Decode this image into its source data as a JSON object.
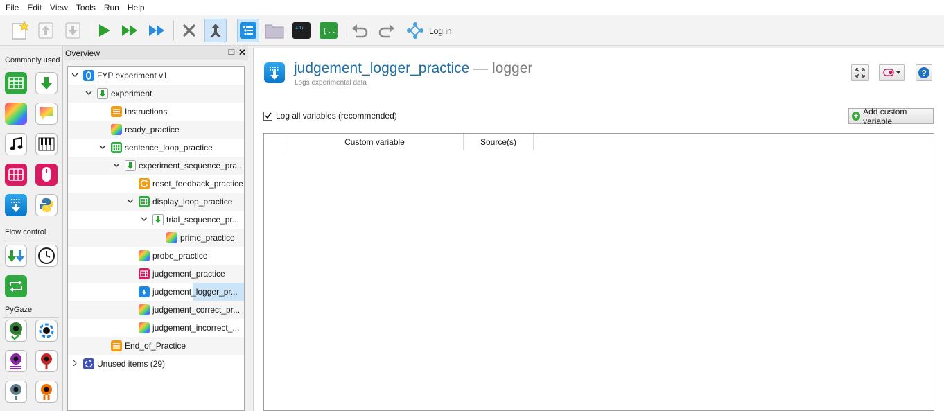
{
  "menu": [
    "File",
    "Edit",
    "View",
    "Tools",
    "Run",
    "Help"
  ],
  "toolbar": {
    "login_label": "Log in",
    "buttons": [
      "new-experiment",
      "move-up",
      "move-down",
      "run",
      "run-in-window",
      "quick-run",
      "kill",
      "merge",
      "overview",
      "file-pool",
      "console",
      "variable-inspector",
      "undo",
      "redo"
    ]
  },
  "itembar": {
    "sections": [
      "Commonly used",
      "Flow control",
      "PyGaze"
    ]
  },
  "overview": {
    "title": "Overview",
    "tree": [
      {
        "label": "FYP experiment v1",
        "icon": "opensesame",
        "level": 0,
        "arrow": "down"
      },
      {
        "label": "experiment",
        "icon": "sequence",
        "level": 1,
        "arrow": "down"
      },
      {
        "label": "Instructions",
        "icon": "form",
        "level": 2,
        "arrow": ""
      },
      {
        "label": "ready_practice",
        "icon": "sketchpad",
        "level": 2,
        "arrow": ""
      },
      {
        "label": "sentence_loop_practice",
        "icon": "loop",
        "level": 2,
        "arrow": "down"
      },
      {
        "label": "experiment_sequence_pra...",
        "icon": "sequence",
        "level": 3,
        "arrow": "down"
      },
      {
        "label": "reset_feedback_practice",
        "icon": "reset",
        "level": 4,
        "arrow": ""
      },
      {
        "label": "display_loop_practice",
        "icon": "loop",
        "level": 4,
        "arrow": "down"
      },
      {
        "label": "trial_sequence_pr...",
        "icon": "sequence",
        "level": 5,
        "arrow": "down"
      },
      {
        "label": "prime_practice",
        "icon": "sketchpad",
        "level": 6,
        "arrow": ""
      },
      {
        "label": "probe_practice",
        "icon": "sketchpad",
        "level": 4,
        "arrow": ""
      },
      {
        "label": "judgement_practice",
        "icon": "keyboard",
        "level": 4,
        "arrow": ""
      },
      {
        "label": "judgement_logger_pr...",
        "icon": "logger",
        "level": 4,
        "arrow": "",
        "selected": true
      },
      {
        "label": "judgement_correct_pr...",
        "icon": "sketchpad",
        "level": 4,
        "arrow": ""
      },
      {
        "label": "judgement_incorrect_...",
        "icon": "sketchpad",
        "level": 4,
        "arrow": ""
      },
      {
        "label": "End_of_Practice",
        "icon": "form",
        "level": 2,
        "arrow": ""
      },
      {
        "label": "Unused items (29)",
        "icon": "recycle",
        "level": 0,
        "arrow": "right"
      }
    ]
  },
  "main": {
    "item_name": "judgement_logger_practice",
    "item_type": " — logger",
    "subtitle": "Logs experimental data",
    "log_all_label": "Log all variables (recommended)",
    "log_all_checked": true,
    "add_button_label": "Add custom variable",
    "columns": [
      "",
      "Custom variable",
      "Source(s)"
    ]
  },
  "colors": {
    "accent": "#1c6ea4",
    "selection": "#cce4f7"
  }
}
